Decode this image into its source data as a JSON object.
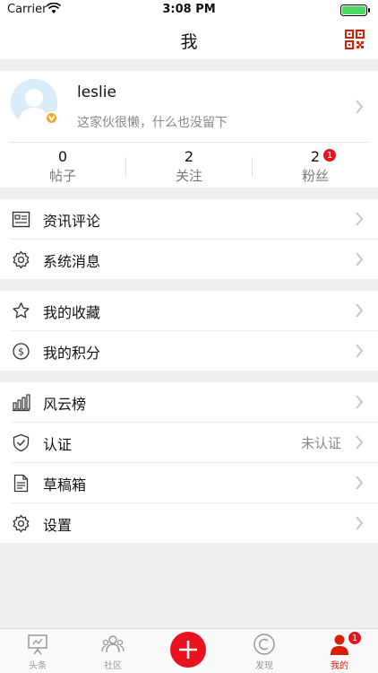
{
  "status_bar": {
    "carrier": "Carrier",
    "time": "3:08 PM"
  },
  "nav": {
    "title": "我",
    "qr_icon": "qr-code-icon"
  },
  "profile": {
    "username": "leslie",
    "bio": "这家伙很懒，什么也没留下",
    "stats": [
      {
        "value": "0",
        "label": "帖子"
      },
      {
        "value": "2",
        "label": "关注"
      },
      {
        "value": "2",
        "label": "粉丝",
        "badge": "1"
      }
    ]
  },
  "menu_groups": [
    [
      {
        "icon": "news-icon",
        "label": "资讯评论"
      },
      {
        "icon": "gear-icon",
        "label": "系统消息"
      }
    ],
    [
      {
        "icon": "star-icon",
        "label": "我的收藏"
      },
      {
        "icon": "dollar-coin-icon",
        "label": "我的积分"
      }
    ],
    [
      {
        "icon": "bar-chart-icon",
        "label": "风云榜"
      },
      {
        "icon": "shield-check-icon",
        "label": "认证",
        "value": "未认证"
      },
      {
        "icon": "document-icon",
        "label": "草稿箱"
      },
      {
        "icon": "gear-icon",
        "label": "设置"
      }
    ]
  ],
  "tabbar": {
    "items": [
      {
        "icon": "easel-icon",
        "label": "头条"
      },
      {
        "icon": "community-icon",
        "label": "社区"
      },
      {
        "icon": "plus-icon",
        "label": ""
      },
      {
        "icon": "discover-icon",
        "label": "发现"
      },
      {
        "icon": "user-icon",
        "label": "我的",
        "badge": "1",
        "active": true
      }
    ]
  },
  "colors": {
    "accent": "#e8131e",
    "muted": "#888888",
    "background": "#efefef"
  }
}
